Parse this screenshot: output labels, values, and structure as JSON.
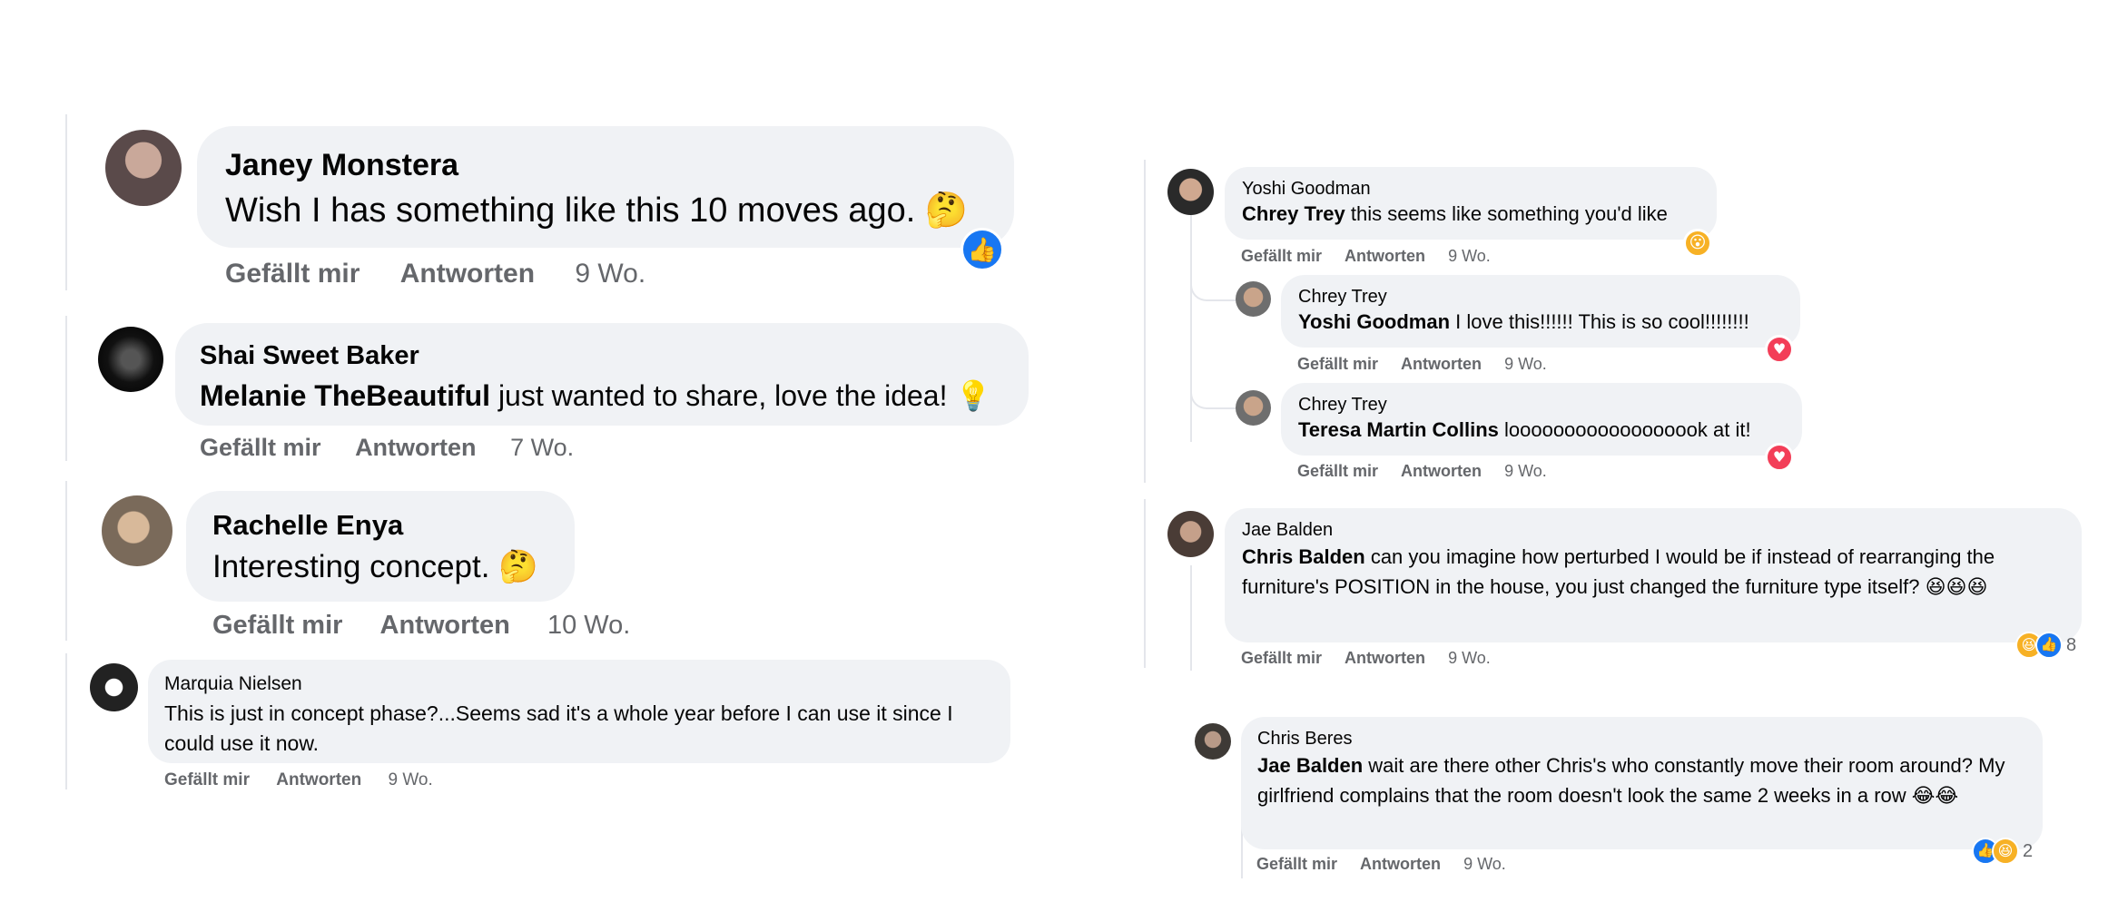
{
  "actions": {
    "like": "Gefällt mir",
    "reply": "Antworten"
  },
  "colors": {
    "bubble": "#f0f2f5",
    "like_blue": "#1877f2",
    "love_red": "#f33e58",
    "muted": "#65676b",
    "thread_line": "#e4e6eb"
  },
  "left": [
    {
      "author": "Janey Monstera",
      "mention": "",
      "text": "Wish I has something like this 10 moves ago.",
      "emoji": "🤔",
      "time": "9 Wo.",
      "reaction": "like-icon"
    },
    {
      "author": "Shai Sweet Baker",
      "mention": "Melanie TheBeautiful",
      "text": " just wanted to share, love the idea!",
      "emoji": "💡",
      "time": "7 Wo."
    },
    {
      "author": "Rachelle Enya",
      "mention": "",
      "text": "Interesting concept.",
      "emoji": "🤔",
      "time": "10 Wo."
    },
    {
      "author": "Marquia Nielsen",
      "mention": "",
      "text": "This is just in concept phase?...Seems sad it's a whole year before I can use it since I could use it now.",
      "emoji": "",
      "time": "9 Wo."
    }
  ],
  "right": [
    {
      "author": "Yoshi Goodman",
      "mention": "Chrey Trey",
      "text": " this seems like something you'd like",
      "time": "9 Wo.",
      "reaction": "wow-icon"
    },
    {
      "author": "Chrey Trey",
      "mention": "Yoshi Goodman",
      "text": " I love this!!!!!! This is so cool!!!!!!!!",
      "time": "9 Wo.",
      "reaction": "love-icon"
    },
    {
      "author": "Chrey Trey",
      "mention": "Teresa Martin Collins",
      "text": " loooooooooooooooook at it!",
      "time": "9 Wo.",
      "reaction": "love-icon"
    },
    {
      "author": "Jae Balden",
      "mention": "Chris Balden",
      "text": " can you imagine how perturbed I would be if instead of rearranging the furniture's POSITION in the house, you just changed the furniture type itself?",
      "emoji": "😆😆😆",
      "time": "9 Wo.",
      "reaction_count": "8"
    },
    {
      "author": "Chris Beres",
      "mention": "Jae Balden",
      "text": " wait are there other Chris's who constantly move their room around? My girlfriend complains that the room doesn't look the same 2 weeks in a row",
      "emoji": "😂😂",
      "time": "9 Wo.",
      "reaction_count": "2"
    }
  ]
}
